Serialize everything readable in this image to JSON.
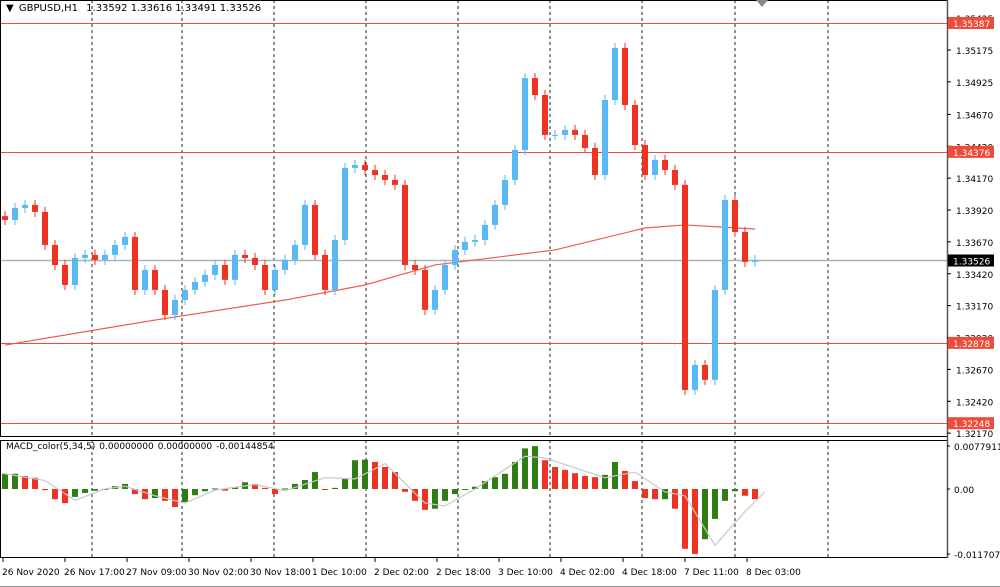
{
  "header": {
    "symbol": "GBPUSD,H1",
    "open": "1.33592",
    "high": "1.33616",
    "low": "1.33491",
    "close": "1.33526"
  },
  "macd_header": {
    "name": "MACD_color(5,34,5)",
    "v1": "0.00000000",
    "v2": "0.00000000",
    "v3": "-0.00144854"
  },
  "colors": {
    "bull": "#5ab9f5",
    "bear": "#ee3322",
    "ma": "#f05a4a",
    "level": "#ef4a3a",
    "macd_up": "#2f7d14",
    "macd_down": "#ee3322",
    "signal": "#c8c8c8",
    "current": "#a9b3bd"
  },
  "chart_data": [
    {
      "type": "candlestick",
      "title": "GBPUSD,H1",
      "ylim": [
        1.3212,
        1.3555
      ],
      "y_ticks": [
        "1.35425",
        "1.35175",
        "1.34925",
        "1.34670",
        "1.34420",
        "1.34170",
        "1.33920",
        "1.33670",
        "1.33420",
        "1.33170",
        "1.32920",
        "1.32670",
        "1.32420",
        "1.32170"
      ],
      "x_ticks": [
        "26 Nov 2020",
        "26 Nov 17:00",
        "27 Nov 09:00",
        "30 Nov 02:00",
        "30 Nov 18:00",
        "1 Dec 10:00",
        "2 Dec 02:00",
        "2 Dec 18:00",
        "3 Dec 10:00",
        "4 Dec 02:00",
        "4 Dec 18:00",
        "7 Dec 11:00",
        "8 Dec 03:00"
      ],
      "close": [
        1.33842,
        1.33936,
        1.3396,
        1.33905,
        1.33646,
        1.33489,
        1.33332,
        1.33544,
        1.33568,
        1.33529,
        1.33568,
        1.33646,
        1.33709,
        1.33293,
        1.3345,
        1.33293,
        1.33097,
        1.33215,
        1.33293,
        1.33356,
        1.33411,
        1.33489,
        1.33372,
        1.33568,
        1.33544,
        1.33489,
        1.33293,
        1.3345,
        1.33529,
        1.33646,
        1.3396,
        1.33568,
        1.33293,
        1.33685,
        1.3425,
        1.34273,
        1.34234,
        1.34195,
        1.34156,
        1.34117,
        1.33489,
        1.3345,
        1.33137,
        1.33293,
        1.33489,
        1.33607,
        1.3367,
        1.33685,
        1.33803,
        1.3396,
        1.34156,
        1.34391,
        1.34955,
        1.34822,
        1.34509,
        1.34509,
        1.34548,
        1.34509,
        1.34407,
        1.34195,
        1.34783,
        1.35191,
        1.34744,
        1.3443,
        1.34195,
        1.34313,
        1.34234,
        1.34117,
        1.32509,
        1.32705,
        1.32588,
        1.33293,
        1.33999,
        1.33748,
        1.33513,
        1.33526
      ],
      "moving_average": [
        [
          0,
          1.32861
        ],
        [
          15,
          1.33057
        ],
        [
          28,
          1.33214
        ],
        [
          36,
          1.33332
        ],
        [
          43,
          1.33489
        ],
        [
          55,
          1.33607
        ],
        [
          64,
          1.33779
        ],
        [
          68,
          1.33803
        ],
        [
          75,
          1.33771
        ]
      ],
      "levels": [
        {
          "value": 1.35387,
          "label": "1.35387"
        },
        {
          "value": 1.34376,
          "label": "1.34376"
        },
        {
          "value": 1.32878,
          "label": "1.32878"
        },
        {
          "value": 1.32248,
          "label": "1.32248"
        }
      ],
      "current_price": {
        "value": 1.33526,
        "label": "1.33526"
      }
    },
    {
      "type": "bar",
      "title": "MACD_color(5,34,5)",
      "ylim": [
        -0.011707,
        0.0077911
      ],
      "y_ticks": [
        "0.0077911",
        "0.00",
        "-0.0117070"
      ],
      "histogram": [
        0.0027,
        0.0027,
        0.0023,
        0.002,
        -0.0002,
        -0.0018,
        -0.0025,
        -0.0014,
        -0.0007,
        -0.0003,
        -0.0001,
        0.0005,
        0.0009,
        -0.0009,
        -0.0018,
        -0.0016,
        -0.0021,
        -0.0032,
        -0.0023,
        -0.0011,
        -0.0004,
        0.0001,
        -0.0003,
        0.0003,
        0.0012,
        0.0009,
        0.0002,
        -0.0009,
        0.0001,
        0.0009,
        0.0016,
        0.003,
        0.0,
        0.0002,
        0.0018,
        0.0051,
        0.0052,
        0.0048,
        0.0039,
        0.003,
        -0.0005,
        -0.0021,
        -0.0037,
        -0.0035,
        -0.0021,
        -0.0009,
        0.0,
        0.0004,
        0.0014,
        0.0021,
        0.0027,
        0.0048,
        0.0072,
        0.0076,
        0.0051,
        0.0039,
        0.0034,
        0.0028,
        0.0023,
        0.0021,
        0.0025,
        0.0048,
        0.0032,
        0.0014,
        -0.0016,
        -0.0018,
        -0.0018,
        -0.0035,
        -0.0106,
        -0.0115,
        -0.0089,
        -0.0053,
        -0.0021,
        -0.0004,
        -0.0012,
        -0.0018
      ],
      "signal": [
        [
          0,
          0.0027
        ],
        [
          4,
          0.0015
        ],
        [
          7,
          -0.002
        ],
        [
          10,
          0.0
        ],
        [
          12,
          0.0005
        ],
        [
          15,
          -0.0012
        ],
        [
          18,
          -0.0025
        ],
        [
          21,
          -0.0002
        ],
        [
          25,
          0.0008
        ],
        [
          28,
          -0.0003
        ],
        [
          32,
          0.002
        ],
        [
          35,
          0.0018
        ],
        [
          38,
          0.0045
        ],
        [
          42,
          -0.0025
        ],
        [
          44,
          -0.003
        ],
        [
          47,
          0.0
        ],
        [
          52,
          0.0058
        ],
        [
          54,
          0.0055
        ],
        [
          60,
          0.002
        ],
        [
          63,
          0.003
        ],
        [
          66,
          -0.0005
        ],
        [
          68,
          -0.0012
        ],
        [
          71,
          -0.01
        ],
        [
          74,
          -0.004
        ],
        [
          76,
          -0.0005
        ]
      ]
    }
  ]
}
